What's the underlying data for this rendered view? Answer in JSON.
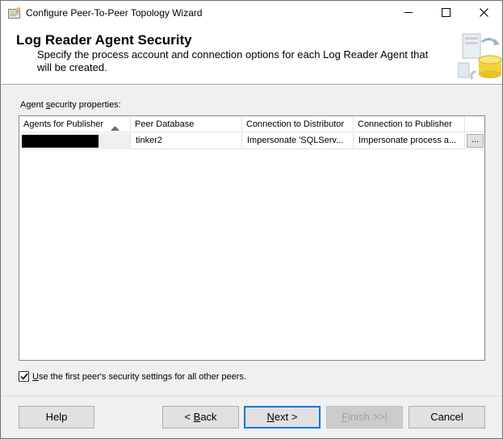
{
  "window": {
    "title": "Configure Peer-To-Peer Topology Wizard"
  },
  "header": {
    "title": "Log Reader Agent Security",
    "description": "Specify the process account and connection options for each Log Reader Agent that will be created."
  },
  "section": {
    "label_pre": "Agent ",
    "label_accel": "s",
    "label_post": "ecurity properties:"
  },
  "grid": {
    "columns": [
      "Agents for Publisher",
      "Peer Database",
      "Connection to Distributor",
      "Connection to Publisher"
    ],
    "rows": [
      {
        "agent": "",
        "peer_database": "tinker2",
        "distributor": "Impersonate 'SQLServ...",
        "publisher": "Impersonate process a...",
        "button": "..."
      }
    ]
  },
  "checkbox": {
    "label_accel": "U",
    "label_post": "se the first peer's security settings for all other peers.",
    "checked": true
  },
  "buttons": {
    "help": "Help",
    "back_pre": "< ",
    "back_accel": "B",
    "back_post": "ack",
    "next_accel": "N",
    "next_post": "ext >",
    "finish_accel": "F",
    "finish_post": "inish >>|",
    "cancel": "Cancel"
  }
}
